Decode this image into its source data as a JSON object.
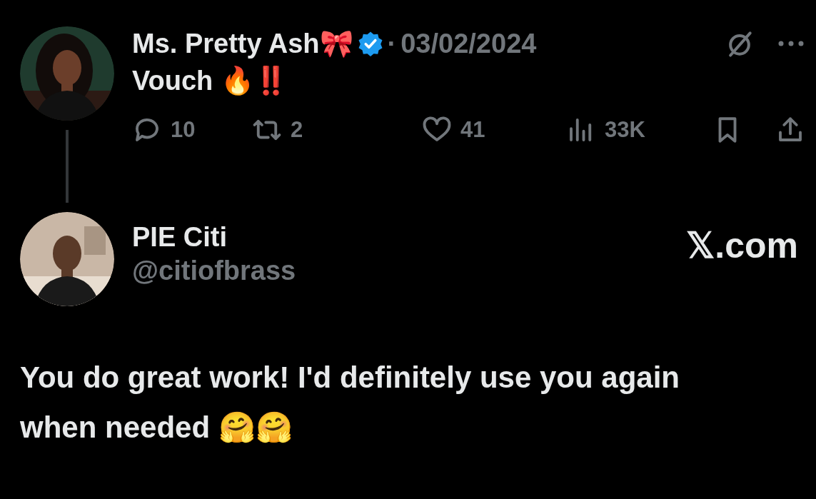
{
  "post": {
    "author": "Ms. Pretty Ash🎀",
    "verified": true,
    "separator": "·",
    "date": "03/02/2024",
    "text": "Vouch 🔥‼️",
    "actions": [
      {
        "kind": "reply",
        "count": "10"
      },
      {
        "kind": "repost",
        "count": "2"
      },
      {
        "kind": "like",
        "count": "41"
      },
      {
        "kind": "views",
        "count": "33K"
      },
      {
        "kind": "bookmark"
      },
      {
        "kind": "share"
      }
    ]
  },
  "reply": {
    "name": "PIE Citi",
    "handle": "@citiofbrass",
    "brand": "𝕏.com",
    "text": "You do great work! I'd definitely use you again when needed 🤗🤗"
  }
}
